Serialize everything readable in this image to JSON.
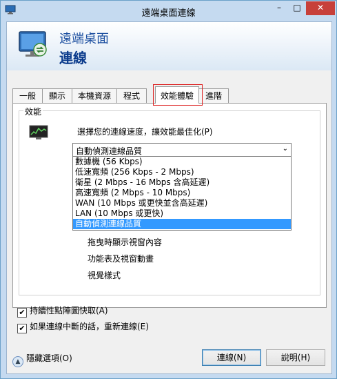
{
  "window": {
    "title": "遠端桌面連線"
  },
  "header": {
    "subtitle": "遠端桌面",
    "title": "連線"
  },
  "tabs": [
    "一般",
    "顯示",
    "本機資源",
    "程式",
    "效能體驗",
    "進階"
  ],
  "active_tab": "效能體驗",
  "performance": {
    "group_label": "效能",
    "prompt": "選擇您的連線速度，讓效能最佳化(P)",
    "select_value": "自動偵測連線品質",
    "options": [
      "數據機 (56 Kbps)",
      "低速寬頻 (256 Kbps - 2 Mbps)",
      "衛星 (2 Mbps - 16 Mbps 含高延遲)",
      "高速寬頻 (2 Mbps - 10 Mbps)",
      "WAN (10 Mbps 或更快並含高延遲)",
      "LAN (10 Mbps 或更快)",
      "自動偵測連線品質"
    ],
    "features": [
      "拖曳時顯示視窗內容",
      "功能表及視窗動畫",
      "視覺樣式"
    ]
  },
  "checkboxes": [
    {
      "label": "持續性點陣圖快取(A)",
      "checked": "✔"
    },
    {
      "label": "如果連線中斷的話，重新連線(E)",
      "checked": "✔"
    }
  ],
  "footer": {
    "hide_options": "隱藏選項(O)",
    "connect": "連線(N)",
    "help": "說明(H)"
  }
}
